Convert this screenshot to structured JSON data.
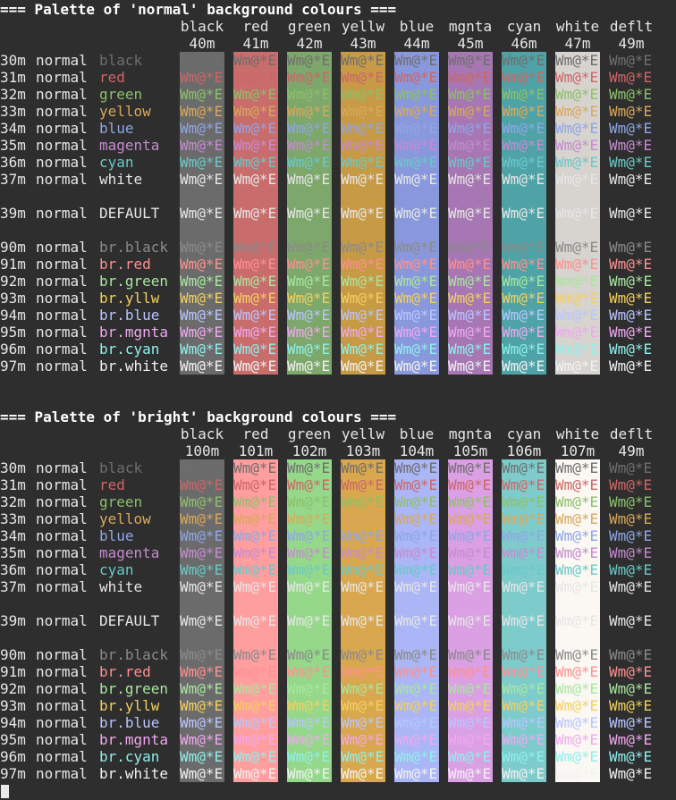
{
  "colors": {
    "terminal_bg": "#2e2e2e",
    "terminal_fg": "#e6e6e6",
    "normal_fg": {
      "30m": "#6e6e6e",
      "31m": "#cc6666",
      "32m": "#8cc06a",
      "33m": "#d9a85a",
      "34m": "#8ea6e6",
      "35m": "#c58bd0",
      "36m": "#6ac8c8",
      "37m": "#e6e6e6",
      "39m": "#e6e6e6"
    },
    "bright_fg": {
      "90m": "#8a8a8a",
      "91m": "#ff8f8f",
      "92m": "#a8e6a0",
      "93m": "#f2d060",
      "94m": "#b8c6ff",
      "95m": "#f0a8f0",
      "96m": "#8ef0ec",
      "97m": "#f2f2f2"
    },
    "normal_bg": {
      "40m": "#6b6b6b",
      "41m": "#c96c6c",
      "42m": "#7da76b",
      "43m": "#c79a45",
      "44m": "#8998dc",
      "45m": "#a677b2",
      "46m": "#4fa3a6",
      "47m": "#d7d3cf",
      "49m": ""
    },
    "bright_bg": {
      "100m": "#6b6b6b",
      "101m": "#ff9e9e",
      "102m": "#95d88a",
      "103m": "#d9a74e",
      "104m": "#aab6f5",
      "105m": "#dba0e4",
      "106m": "#7ecbcc",
      "107m": "#fbf8f3",
      "49m": ""
    }
  },
  "sample_text": "Wm@*E",
  "default_label": "DEFAULT",
  "sections": [
    {
      "title": "=== Palette of 'normal' background colours ===",
      "columns": [
        {
          "name": "black",
          "code": "40m"
        },
        {
          "name": "red",
          "code": "41m"
        },
        {
          "name": "green",
          "code": "42m"
        },
        {
          "name": "yellw",
          "code": "43m"
        },
        {
          "name": "blue",
          "code": "44m"
        },
        {
          "name": "mgnta",
          "code": "45m"
        },
        {
          "name": "cyan",
          "code": "46m"
        },
        {
          "name": "white",
          "code": "47m"
        },
        {
          "name": "deflt",
          "code": "49m"
        }
      ],
      "rows": [
        {
          "code": "30m",
          "mode": "normal",
          "label": "black"
        },
        {
          "code": "31m",
          "mode": "normal",
          "label": "red"
        },
        {
          "code": "32m",
          "mode": "normal",
          "label": "green"
        },
        {
          "code": "33m",
          "mode": "normal",
          "label": "yellow"
        },
        {
          "code": "34m",
          "mode": "normal",
          "label": "blue"
        },
        {
          "code": "35m",
          "mode": "normal",
          "label": "magenta"
        },
        {
          "code": "36m",
          "mode": "normal",
          "label": "cyan"
        },
        {
          "code": "37m",
          "mode": "normal",
          "label": "white"
        },
        null,
        {
          "code": "39m",
          "mode": "normal",
          "label": "DEFAULT"
        },
        null,
        {
          "code": "90m",
          "mode": "normal",
          "label": "br.black"
        },
        {
          "code": "91m",
          "mode": "normal",
          "label": "br.red"
        },
        {
          "code": "92m",
          "mode": "normal",
          "label": "br.green"
        },
        {
          "code": "93m",
          "mode": "normal",
          "label": "br.yllw"
        },
        {
          "code": "94m",
          "mode": "normal",
          "label": "br.blue"
        },
        {
          "code": "95m",
          "mode": "normal",
          "label": "br.mgnta"
        },
        {
          "code": "96m",
          "mode": "normal",
          "label": "br.cyan"
        },
        {
          "code": "97m",
          "mode": "normal",
          "label": "br.white"
        }
      ]
    },
    {
      "title": "=== Palette of 'bright' background colours ===",
      "columns": [
        {
          "name": "black",
          "code": "100m"
        },
        {
          "name": "red",
          "code": "101m"
        },
        {
          "name": "green",
          "code": "102m"
        },
        {
          "name": "yellw",
          "code": "103m"
        },
        {
          "name": "blue",
          "code": "104m"
        },
        {
          "name": "mgnta",
          "code": "105m"
        },
        {
          "name": "cyan",
          "code": "106m"
        },
        {
          "name": "white",
          "code": "107m"
        },
        {
          "name": "deflt",
          "code": "49m"
        }
      ],
      "rows": [
        {
          "code": "30m",
          "mode": "normal",
          "label": "black"
        },
        {
          "code": "31m",
          "mode": "normal",
          "label": "red"
        },
        {
          "code": "32m",
          "mode": "normal",
          "label": "green"
        },
        {
          "code": "33m",
          "mode": "normal",
          "label": "yellow"
        },
        {
          "code": "34m",
          "mode": "normal",
          "label": "blue"
        },
        {
          "code": "35m",
          "mode": "normal",
          "label": "magenta"
        },
        {
          "code": "36m",
          "mode": "normal",
          "label": "cyan"
        },
        {
          "code": "37m",
          "mode": "normal",
          "label": "white"
        },
        null,
        {
          "code": "39m",
          "mode": "normal",
          "label": "DEFAULT"
        },
        null,
        {
          "code": "90m",
          "mode": "normal",
          "label": "br.black"
        },
        {
          "code": "91m",
          "mode": "normal",
          "label": "br.red"
        },
        {
          "code": "92m",
          "mode": "normal",
          "label": "br.green"
        },
        {
          "code": "93m",
          "mode": "normal",
          "label": "br.yllw"
        },
        {
          "code": "94m",
          "mode": "normal",
          "label": "br.blue"
        },
        {
          "code": "95m",
          "mode": "normal",
          "label": "br.mgnta"
        },
        {
          "code": "96m",
          "mode": "normal",
          "label": "br.cyan"
        },
        {
          "code": "97m",
          "mode": "normal",
          "label": "br.white"
        }
      ]
    }
  ]
}
